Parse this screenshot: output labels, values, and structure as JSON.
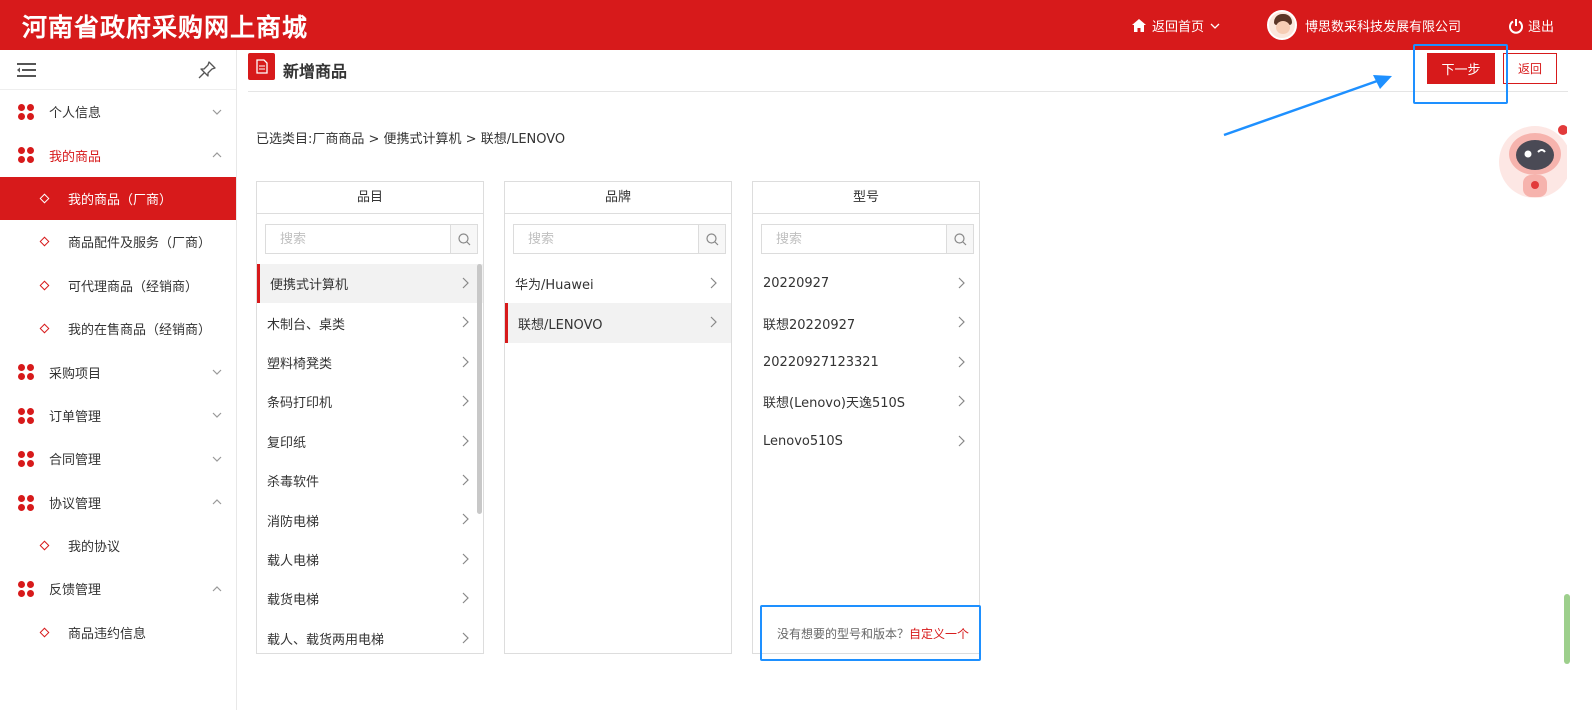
{
  "topbar": {
    "title": "河南省政府采购网上商城",
    "home_label": "返回首页",
    "company": "博思数采科技发展有限公司",
    "logout_label": "退出"
  },
  "sidebar": {
    "items": [
      {
        "label": "个人信息",
        "type": "group",
        "caret": "down"
      },
      {
        "label": "我的商品",
        "type": "group",
        "caret": "up",
        "open": true
      },
      {
        "label": "我的商品（厂商）",
        "type": "sub",
        "active": true
      },
      {
        "label": "商品配件及服务（厂商）",
        "type": "sub"
      },
      {
        "label": "可代理商品（经销商）",
        "type": "sub"
      },
      {
        "label": "我的在售商品（经销商）",
        "type": "sub"
      },
      {
        "label": "采购项目",
        "type": "group",
        "caret": "down"
      },
      {
        "label": "订单管理",
        "type": "group",
        "caret": "down"
      },
      {
        "label": "合同管理",
        "type": "group",
        "caret": "down"
      },
      {
        "label": "协议管理",
        "type": "group",
        "caret": "up"
      },
      {
        "label": "我的协议",
        "type": "sub"
      },
      {
        "label": "反馈管理",
        "type": "group",
        "caret": "up"
      },
      {
        "label": "商品违约信息",
        "type": "sub"
      }
    ]
  },
  "main": {
    "title": "新增商品",
    "next_label": "下一步",
    "back_label": "返回",
    "breadcrumb": "已选类目:厂商商品 > 便携式计算机 > 联想/LENOVO",
    "search_placeholder": "搜索",
    "panels": [
      {
        "title": "品目",
        "items": [
          "便携式计算机",
          "木制台、桌类",
          "塑料椅凳类",
          "条码打印机",
          "复印纸",
          "杀毒软件",
          "消防电梯",
          "载人电梯",
          "载货电梯",
          "载人、载货两用电梯"
        ],
        "selected": 0
      },
      {
        "title": "品牌",
        "items": [
          "华为/Huawei",
          "联想/LENOVO"
        ],
        "selected": 1
      },
      {
        "title": "型号",
        "items": [
          "20220927",
          "联想20220927",
          "20220927123321",
          "联想(Lenovo)天逸510S",
          "Lenovo510S"
        ],
        "selected": -1
      }
    ],
    "custom_tip": "没有想要的型号和版本？",
    "custom_link": "自定义一个"
  },
  "colors": {
    "brand": "#d71a1b",
    "highlight": "#1e90ff"
  }
}
